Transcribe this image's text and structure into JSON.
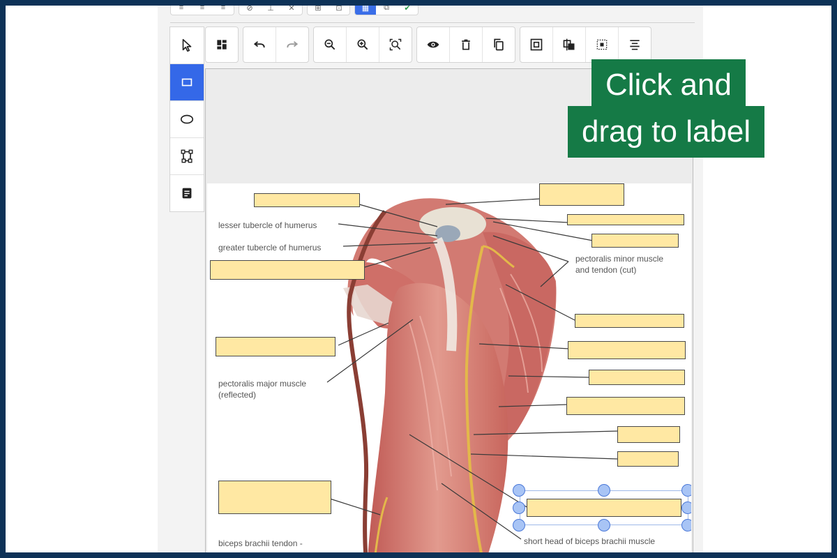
{
  "top_strip": {
    "groups": [
      [
        "≡",
        "≡",
        "≡"
      ],
      [
        "⊘",
        "⊥",
        "✕"
      ],
      [
        "⊞",
        "⊡"
      ],
      [
        "▦",
        "⧉",
        "✔"
      ]
    ]
  },
  "left_toolbar": {
    "tools": [
      {
        "name": "select-tool",
        "icon": "pointer-icon",
        "active": false
      },
      {
        "name": "rectangle-tool",
        "icon": "rectangle-icon",
        "active": true
      },
      {
        "name": "ellipse-tool",
        "icon": "ellipse-icon",
        "active": false
      },
      {
        "name": "polygon-tool",
        "icon": "polygon-icon",
        "active": false
      },
      {
        "name": "notes-tool",
        "icon": "notes-icon",
        "active": false
      }
    ]
  },
  "main_toolbar": {
    "groups": [
      [
        {
          "name": "layout-button",
          "icon": "layout-icon"
        }
      ],
      [
        {
          "name": "undo-button",
          "icon": "undo-icon"
        },
        {
          "name": "redo-button",
          "icon": "redo-icon",
          "disabled": true
        }
      ],
      [
        {
          "name": "zoom-out-button",
          "icon": "zoom-out-icon"
        },
        {
          "name": "zoom-in-button",
          "icon": "zoom-in-icon"
        },
        {
          "name": "zoom-fit-button",
          "icon": "zoom-fit-icon"
        }
      ],
      [
        {
          "name": "visibility-button",
          "icon": "eye-icon"
        },
        {
          "name": "delete-button",
          "icon": "trash-icon"
        },
        {
          "name": "duplicate-button",
          "icon": "copy-icon"
        }
      ],
      [
        {
          "name": "bring-front-button",
          "icon": "bring-front-icon"
        },
        {
          "name": "send-back-button",
          "icon": "send-back-icon"
        },
        {
          "name": "select-region-button",
          "icon": "region-icon"
        },
        {
          "name": "align-button",
          "icon": "align-icon"
        }
      ]
    ]
  },
  "instruction": {
    "line1": "Click and",
    "line2": "drag to label",
    "bg_color": "#157a46"
  },
  "diagram": {
    "annotations": {
      "lesser_tubercle": "lesser tubercle of humerus",
      "greater_tubercle": "greater tubercle of humerus",
      "pectoralis_minor_1": "pectoralis minor muscle",
      "pectoralis_minor_2": "and tendon (cut)",
      "pectoralis_major_1": "pectoralis major muscle",
      "pectoralis_major_2": "(reflected)",
      "biceps_tendon": "biceps brachii tendon -",
      "short_head": "short head of biceps brachii muscle"
    },
    "label_box_color": "#ffe8a3",
    "label_box_count": 16,
    "selected_box": 16
  }
}
